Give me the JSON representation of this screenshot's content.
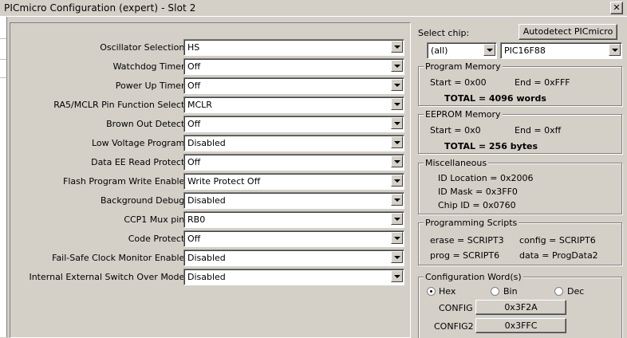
{
  "window": {
    "title": "PICmicro Configuration (expert) - Slot 2",
    "close_glyph": "✕"
  },
  "config_rows": [
    {
      "label": "Oscillator Selection:",
      "value": "HS"
    },
    {
      "label": "Watchdog Timer:",
      "value": "Off"
    },
    {
      "label": "Power Up Timer:",
      "value": "Off"
    },
    {
      "label": "RA5/MCLR Pin Function Select:",
      "value": "MCLR"
    },
    {
      "label": "Brown Out Detect:",
      "value": "Off"
    },
    {
      "label": "Low Voltage Program:",
      "value": "Disabled"
    },
    {
      "label": "Data EE Read Protect:",
      "value": "Off"
    },
    {
      "label": "Flash Program Write Enable:",
      "value": "Write Protect Off"
    },
    {
      "label": "Background Debug:",
      "value": "Disabled"
    },
    {
      "label": "CCP1 Mux pin:",
      "value": "RB0"
    },
    {
      "label": "Code Protect:",
      "value": "Off"
    },
    {
      "label": "Fail-Safe Clock Monitor Enable:",
      "value": "Disabled"
    },
    {
      "label": "Internal External Switch Over Mode:",
      "value": "Disabled"
    }
  ],
  "chip": {
    "select_label": "Select chip:",
    "autodetect_label": "Autodetect PICmicro",
    "family_value": "(all)",
    "chip_value": "PIC16F88"
  },
  "program_memory": {
    "title": "Program Memory",
    "start": "Start = 0x00",
    "end": "End = 0xFFF",
    "total": "TOTAL = 4096 words"
  },
  "eeprom_memory": {
    "title": "EEPROM Memory",
    "start": "Start = 0x0",
    "end": "End = 0xff",
    "total": "TOTAL = 256 bytes"
  },
  "misc": {
    "title": "Miscellaneous",
    "id_location": "ID Location = 0x2006",
    "id_mask": "ID Mask = 0x3FF0",
    "chip_id": "Chip ID = 0x0760"
  },
  "scripts": {
    "title": "Programming Scripts",
    "erase": "erase = SCRIPT3",
    "config": "config = SCRIPT6",
    "prog": "prog = SCRIPT6",
    "data": "data = ProgData2"
  },
  "config_words": {
    "title": "Configuration Word(s)",
    "radio_hex": "Hex",
    "radio_bin": "Bin",
    "radio_dec": "Dec",
    "selected": "Hex",
    "config1_label": "CONFIG",
    "config1_value": "0x3F2A",
    "config2_label": "CONFIG2",
    "config2_value": "0x3FFC"
  }
}
